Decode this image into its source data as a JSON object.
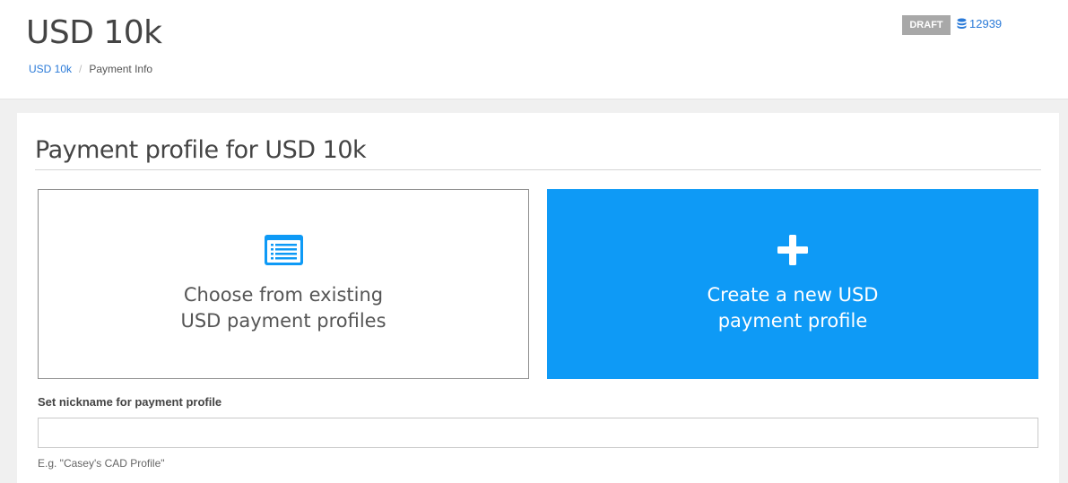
{
  "header": {
    "title": "USD 10k",
    "breadcrumb": {
      "root": "USD 10k",
      "separator": "/",
      "current": "Payment Info"
    },
    "status_badge": "DRAFT",
    "credits": {
      "icon": "database-icon",
      "value": "12939"
    }
  },
  "panel": {
    "title": "Payment profile for USD 10k",
    "options": {
      "existing": {
        "icon": "list-icon",
        "label": "Choose from existing\nUSD payment profiles"
      },
      "new": {
        "icon": "plus-icon",
        "label": "Create a new USD\npayment profile"
      }
    },
    "nickname": {
      "label": "Set nickname for payment profile",
      "value": "",
      "placeholder": "",
      "help": "E.g. \"Casey's CAD Profile\""
    }
  },
  "colors": {
    "accent": "#0e9af6",
    "link": "#2a7ad8",
    "badge": "#a8a8a8"
  }
}
